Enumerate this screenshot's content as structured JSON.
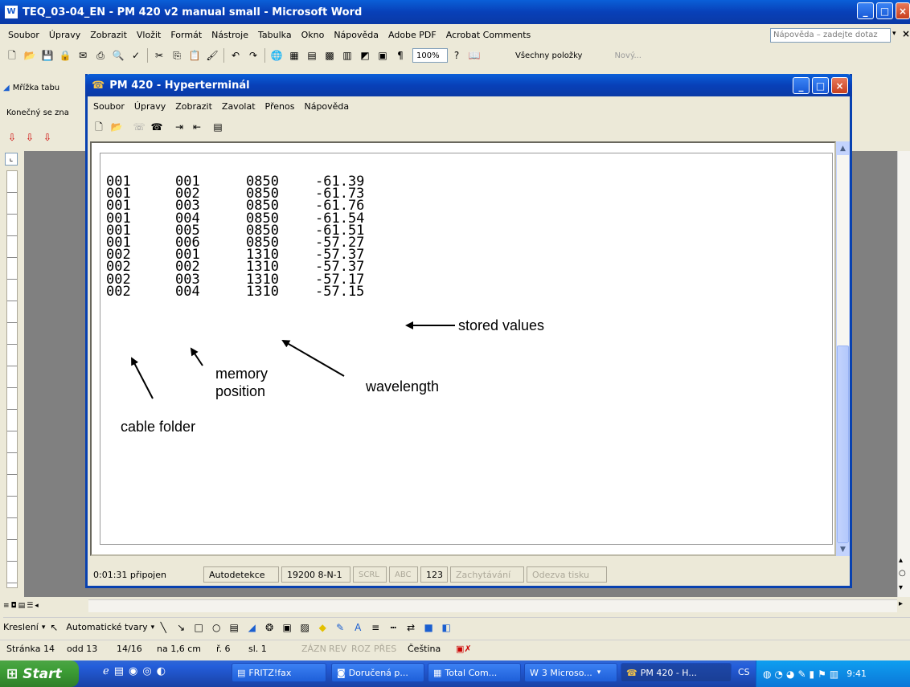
{
  "word": {
    "title": "TEQ_03-04_EN - PM 420 v2 manual small - Microsoft Word",
    "menu": [
      "Soubor",
      "Úpravy",
      "Zobrazit",
      "Vložit",
      "Formát",
      "Nástroje",
      "Tabulka",
      "Okno",
      "Nápověda",
      "Adobe PDF",
      "Acrobat Comments"
    ],
    "help_placeholder": "Nápověda – zadejte dotaz",
    "zoom": "100%",
    "all_items": "Všechny položky",
    "new_label": "Nový...",
    "grid_label": "Mřížka tabu",
    "find_label": "Konečný se zna",
    "drawing": "Kreslení",
    "autoshapes": "Automatické tvary",
    "status": {
      "page": "Stránka 14",
      "section": "odd 13",
      "pages": "14/16",
      "at": "na 1,6 cm",
      "line": "ř. 6",
      "col": "sl. 1",
      "rec": "ZÁZN",
      "rev": "REV",
      "ext": "ROZ",
      "ovr": "PŘES",
      "lang": "Čeština"
    }
  },
  "hyper": {
    "title": "PM 420 - Hyperterminál",
    "menu": [
      "Soubor",
      "Úpravy",
      "Zobrazit",
      "Zavolat",
      "Přenos",
      "Nápověda"
    ],
    "rows": [
      [
        "001",
        "001",
        "0850",
        "-61.39"
      ],
      [
        "001",
        "002",
        "0850",
        "-61.73"
      ],
      [
        "001",
        "003",
        "0850",
        "-61.76"
      ],
      [
        "001",
        "004",
        "0850",
        "-61.54"
      ],
      [
        "001",
        "005",
        "0850",
        "-61.51"
      ],
      [
        "001",
        "006",
        "0850",
        "-57.27"
      ],
      [
        "002",
        "001",
        "1310",
        "-57.37"
      ],
      [
        "002",
        "002",
        "1310",
        "-57.37"
      ],
      [
        "002",
        "003",
        "1310",
        "-57.17"
      ],
      [
        "002",
        "004",
        "1310",
        "-57.15"
      ]
    ],
    "annotations": {
      "stored": "stored values",
      "memory1": "memory",
      "memory2": "position",
      "wavelength": "wavelength",
      "cable": "cable folder"
    },
    "status": {
      "connected": "0:01:31 připojen",
      "detect": "Autodetekce",
      "baud": "19200 8-N-1",
      "scrl": "SCRL",
      "abc": "ABC",
      "num": "123",
      "capture": "Zachytávání",
      "echo": "Odezva tisku"
    }
  },
  "taskbar": {
    "start": "Start",
    "items": [
      "FRITZ!fax",
      "Doručená p...",
      "Total Com...",
      "3 Microso...",
      "PM 420 - H..."
    ],
    "lang": "CS",
    "clock": "9:41"
  },
  "colors": {
    "xp_blue": "#0a5fd8",
    "taskbar": "#245edb",
    "start_green": "#3c9d35"
  }
}
